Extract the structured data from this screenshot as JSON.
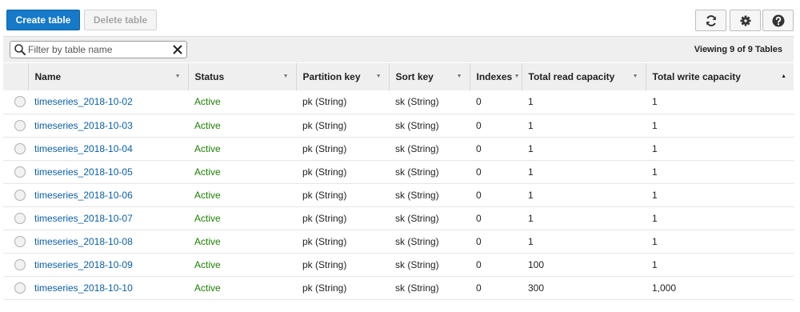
{
  "toolbar": {
    "create_label": "Create table",
    "delete_label": "Delete table"
  },
  "filter": {
    "placeholder": "Filter by table name",
    "viewing": "Viewing 9 of 9 Tables"
  },
  "columns": {
    "name": "Name",
    "status": "Status",
    "partition_key": "Partition key",
    "sort_key": "Sort key",
    "indexes": "Indexes",
    "read_capacity": "Total read capacity",
    "write_capacity": "Total write capacity"
  },
  "rows": [
    {
      "name": "timeseries_2018-10-02",
      "status": "Active",
      "partition_key": "pk (String)",
      "sort_key": "sk (String)",
      "indexes": "0",
      "read": "1",
      "write": "1"
    },
    {
      "name": "timeseries_2018-10-03",
      "status": "Active",
      "partition_key": "pk (String)",
      "sort_key": "sk (String)",
      "indexes": "0",
      "read": "1",
      "write": "1"
    },
    {
      "name": "timeseries_2018-10-04",
      "status": "Active",
      "partition_key": "pk (String)",
      "sort_key": "sk (String)",
      "indexes": "0",
      "read": "1",
      "write": "1"
    },
    {
      "name": "timeseries_2018-10-05",
      "status": "Active",
      "partition_key": "pk (String)",
      "sort_key": "sk (String)",
      "indexes": "0",
      "read": "1",
      "write": "1"
    },
    {
      "name": "timeseries_2018-10-06",
      "status": "Active",
      "partition_key": "pk (String)",
      "sort_key": "sk (String)",
      "indexes": "0",
      "read": "1",
      "write": "1"
    },
    {
      "name": "timeseries_2018-10-07",
      "status": "Active",
      "partition_key": "pk (String)",
      "sort_key": "sk (String)",
      "indexes": "0",
      "read": "1",
      "write": "1"
    },
    {
      "name": "timeseries_2018-10-08",
      "status": "Active",
      "partition_key": "pk (String)",
      "sort_key": "sk (String)",
      "indexes": "0",
      "read": "1",
      "write": "1"
    },
    {
      "name": "timeseries_2018-10-09",
      "status": "Active",
      "partition_key": "pk (String)",
      "sort_key": "sk (String)",
      "indexes": "0",
      "read": "100",
      "write": "1"
    },
    {
      "name": "timeseries_2018-10-10",
      "status": "Active",
      "partition_key": "pk (String)",
      "sort_key": "sk (String)",
      "indexes": "0",
      "read": "300",
      "write": "1,000"
    }
  ],
  "colors": {
    "primary": "#1679c9",
    "link": "#0a5fa6",
    "active": "#1d8102"
  },
  "icons": [
    "refresh-icon",
    "gear-icon",
    "help-icon",
    "search-icon",
    "clear-icon"
  ]
}
